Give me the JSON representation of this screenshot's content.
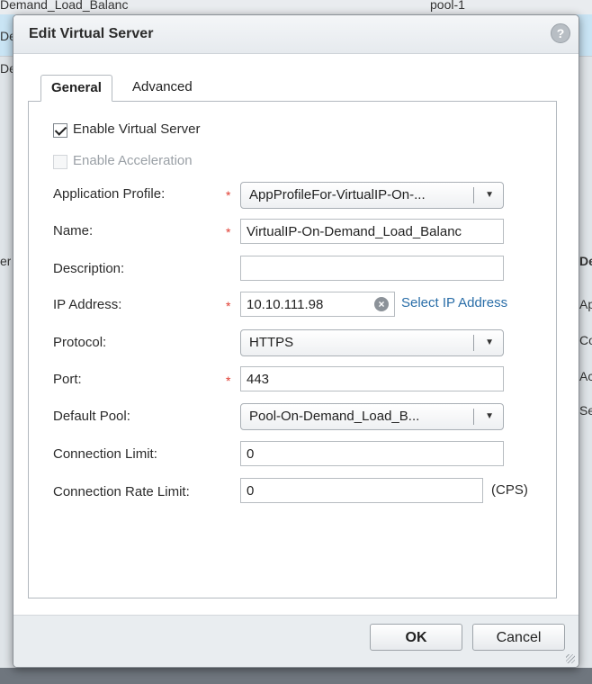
{
  "background": {
    "top_cells": [
      "Demand_Load_Balanc",
      "pool-1"
    ],
    "left_fragments": [
      "De",
      "De",
      "er",
      "",
      ""
    ],
    "right_fragments": [
      "De",
      "Ap",
      "Co",
      "Ac",
      "Se"
    ]
  },
  "dialog": {
    "title": "Edit Virtual Server",
    "help_label": "?",
    "tabs": [
      {
        "label": "General",
        "active": true
      },
      {
        "label": "Advanced",
        "active": false
      }
    ],
    "enable_virtual_server": {
      "label": "Enable Virtual Server",
      "checked": true
    },
    "enable_acceleration": {
      "label": "Enable Acceleration",
      "checked": false,
      "disabled": true
    },
    "application_profile": {
      "label": "Application Profile:",
      "value": "AppProfileFor-VirtualIP-On-..."
    },
    "name": {
      "label": "Name:",
      "value": "VirtualIP-On-Demand_Load_Balanc"
    },
    "description": {
      "label": "Description:",
      "value": ""
    },
    "ip_address": {
      "label": "IP Address:",
      "value": "10.10.111.98",
      "clear_label": "×",
      "link": "Select IP Address"
    },
    "protocol": {
      "label": "Protocol:",
      "value": "HTTPS"
    },
    "port": {
      "label": "Port:",
      "value": "443"
    },
    "default_pool": {
      "label": "Default Pool:",
      "value": "Pool-On-Demand_Load_B..."
    },
    "connection_limit": {
      "label": "Connection Limit:",
      "value": "0"
    },
    "connection_rate_limit": {
      "label": "Connection Rate Limit:",
      "value": "0",
      "unit": "(CPS)"
    },
    "required_marker": "*",
    "dropdown_arrow": "▼",
    "ok_label": "OK",
    "cancel_label": "Cancel"
  },
  "colors": {
    "required": "#e03c31",
    "link": "#2a6ea8"
  }
}
